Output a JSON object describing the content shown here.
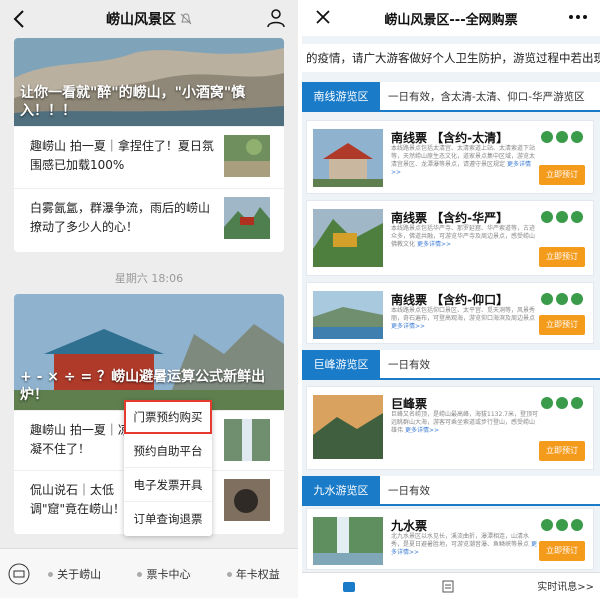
{
  "left": {
    "title": "崂山风景区",
    "article1": {
      "hero_text": "让你一看就\"醉\"的崂山，\"小酒窝\"慎入！！！",
      "rows": [
        {
          "text": "趣崂山 拍一夏｜拿捏住了！夏日氛围感已加载100%"
        },
        {
          "text": "白雾氤氲，群瀑争流，雨后的崂山撩动了多少人的心！"
        }
      ]
    },
    "timestamp": "星期六 18:06",
    "article2": {
      "hero_text": "+ - × ÷ = ？崂山避暑运算公式新鲜出炉！",
      "rows": [
        {
          "text": "趣崂山 拍一夏｜凉凝不住了！"
        },
        {
          "text": "侃山说石｜太低调\"窟\"竟在崂山！"
        }
      ]
    },
    "popup_menu": [
      {
        "label": "门票预约购买",
        "highlighted": true
      },
      {
        "label": "预约自助平台",
        "highlighted": false
      },
      {
        "label": "电子发票开具",
        "highlighted": false
      },
      {
        "label": "订单查询退票",
        "highlighted": false
      }
    ],
    "bottom_menu": [
      "关于崂山",
      "票卡中心",
      "年卡权益"
    ]
  },
  "right": {
    "title": "崂山风景区---全网购票",
    "notice": "的疫情，请广大游客做好个人卫生防护，游览过程中若出现发烧",
    "sections": [
      {
        "tag": "南线游览区",
        "desc": "一日有效，含太清-太清、仰口-华严游览区",
        "tickets": [
          {
            "name": "南线票 【含约-太清】",
            "body": "本线路景点包括太清宫、太清索道上站、太清索道下站等，天然崂山原生态文化，道家景点集中区域，游览太清宫景区、龙潭瀑等景点，请遵守景区规定",
            "more": "更多详情>>",
            "buy": "立即预订"
          },
          {
            "name": "南线票 【含约-华严】",
            "body": "本线路景点包括华严寺、那罗延窟、华严索道等，古迹众多，佛道共融，可游览华严寺及周边景点，感受崂山佛教文化",
            "more": "更多详情>>",
            "buy": "立即预订"
          },
          {
            "name": "南线票 【含约-仰口】",
            "body": "本线路景点包括仰口景区、太平宫、觅天洞等，风景秀丽，奇石遍布，可登高观海，游览仰口海滨及周边景点",
            "more": "更多详情>>",
            "buy": "立即预订"
          }
        ]
      },
      {
        "tag": "巨峰游览区",
        "desc": "一日有效",
        "tickets": [
          {
            "name": "巨峰票",
            "body": "巨峰又名崂顶，是崂山最高峰，海拔1132.7米，登顶可远眺群山大海，游客可乘坐索道或步行登山，感受崂山雄伟",
            "more": "更多详情>>",
            "buy": "立即预订"
          }
        ]
      },
      {
        "tag": "九水游览区",
        "desc": "一日有效",
        "tickets": [
          {
            "name": "九水票",
            "body": "北九水景区以水见长，溪流曲折，瀑潭相连，山清水秀，是夏日避暑胜地，可游览潮音瀑、鱼鳞峡等景点",
            "more": "更多详情>>",
            "buy": "立即预订"
          }
        ]
      }
    ],
    "footer_text": "实时讯息>>"
  },
  "colors": {
    "blue": "#1a7bc9",
    "orange": "#f59b1c",
    "highlight_red": "#e63a2e"
  }
}
